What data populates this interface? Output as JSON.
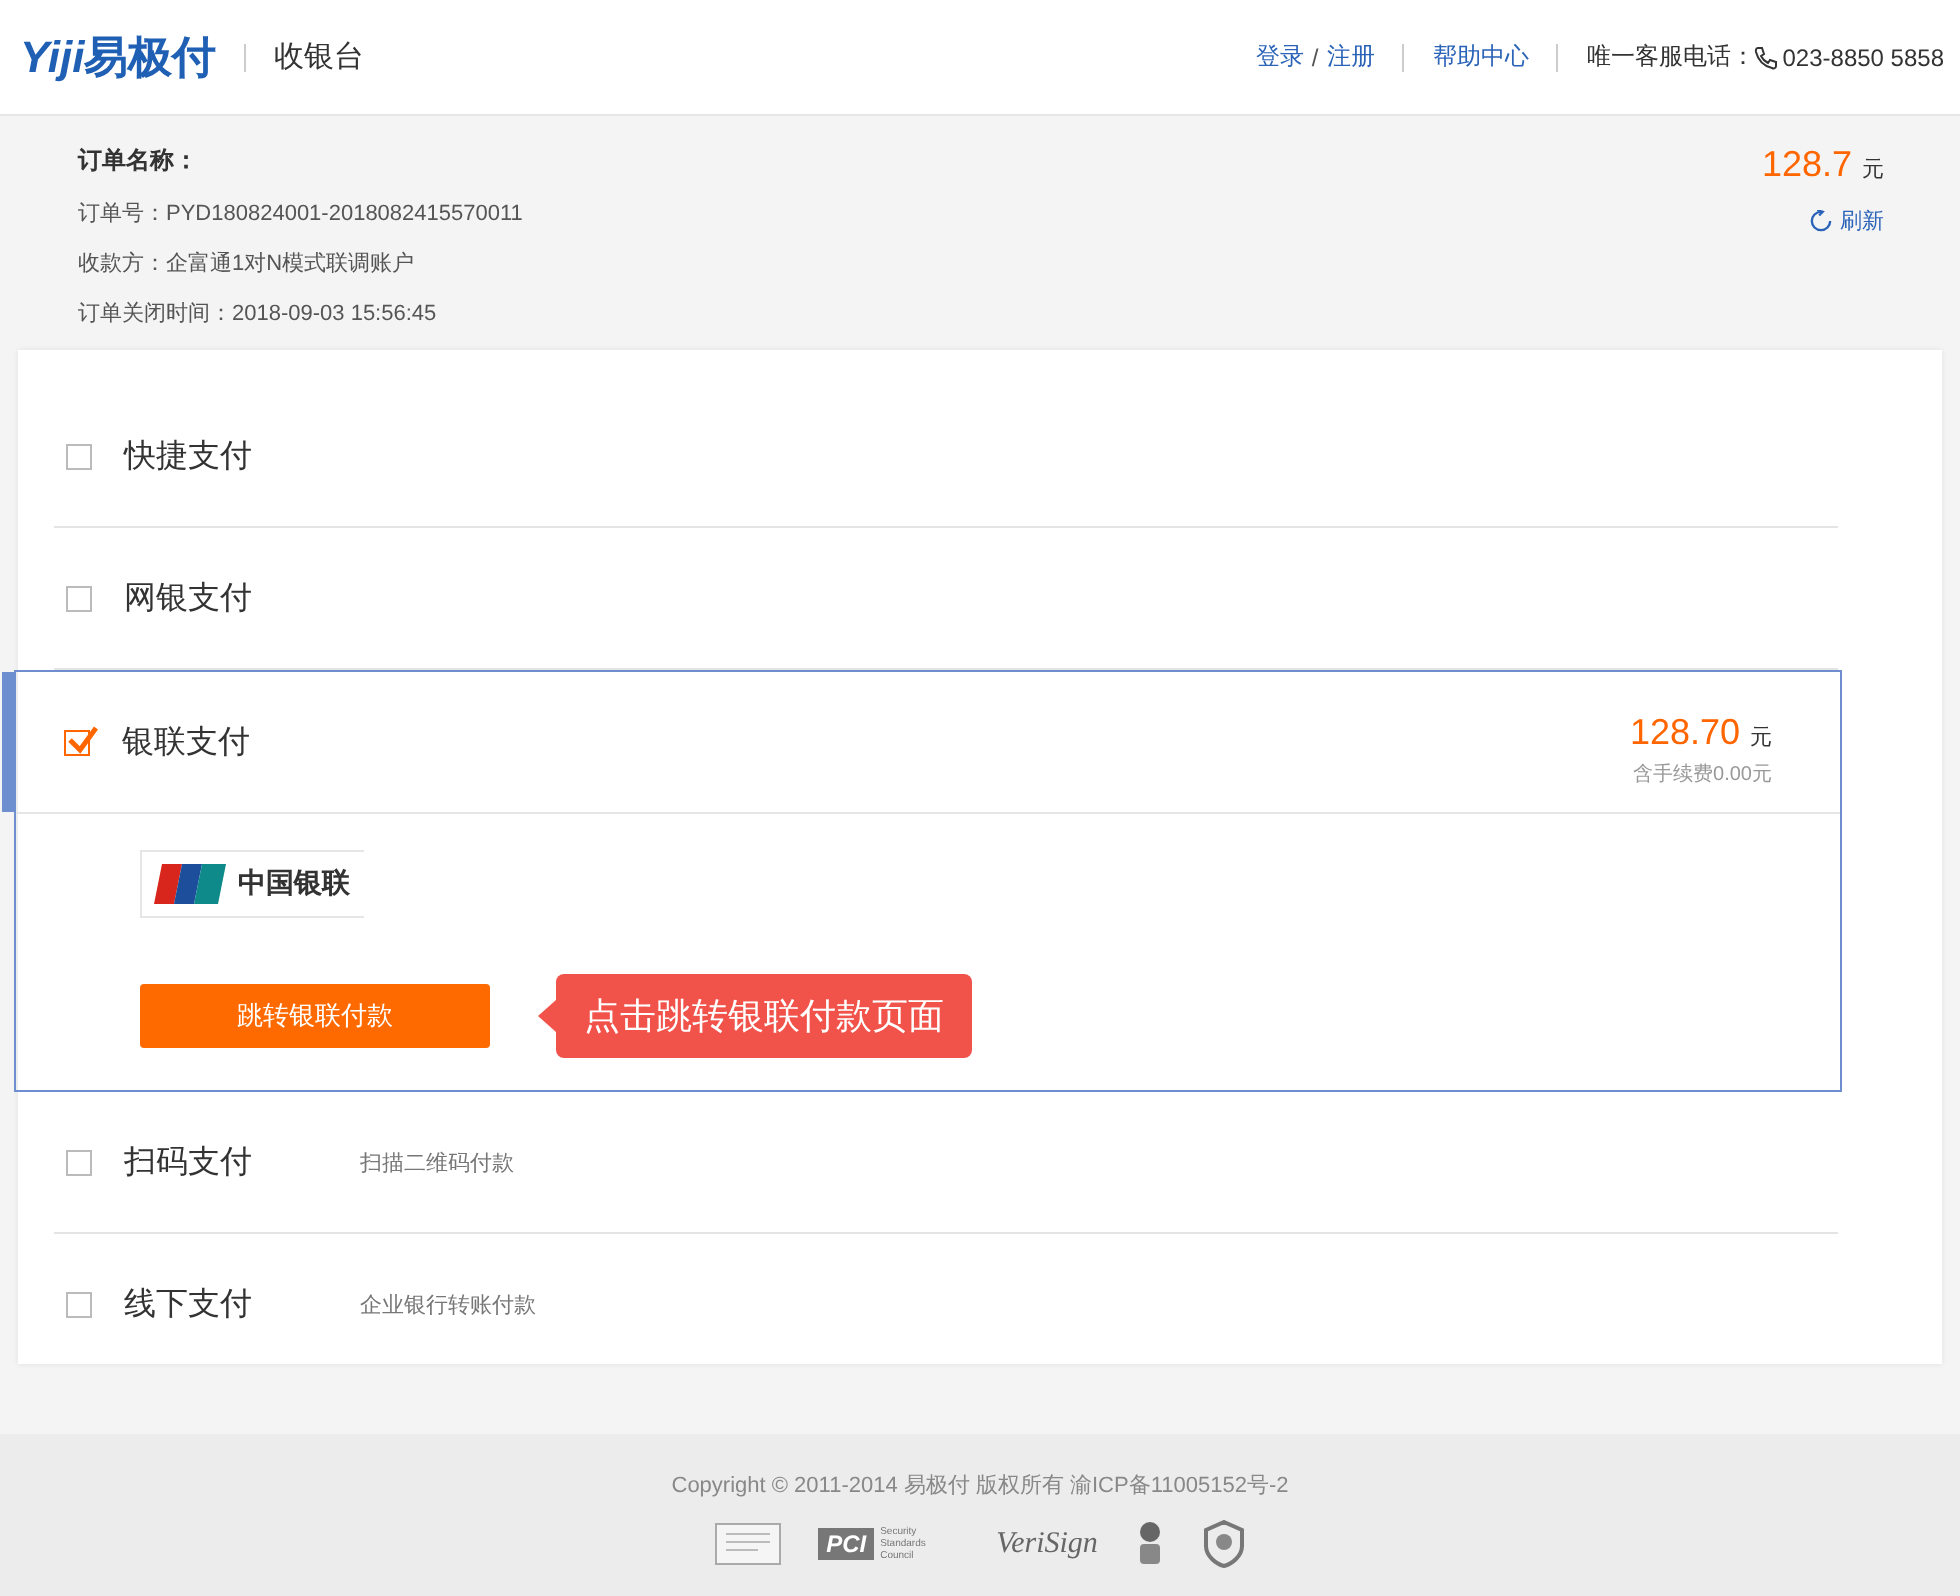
{
  "header": {
    "logo_latin": "Yiji",
    "logo_cn": "易极付",
    "title": "收银台",
    "links": [
      {
        "label": "登录"
      },
      {
        "label": "注册"
      }
    ],
    "link_separator": "/",
    "help": "帮助中心",
    "hotline_label": "唯一客服电话：",
    "hotline": "023-8850 5858"
  },
  "order": {
    "name_label": "订单名称：",
    "details": [
      "订单号：PYD180824001-2018082415570011",
      "收款方：企富通1对N模式联调账户",
      "订单关闭时间：2018-09-03 15:56:45"
    ],
    "amount": "128.7",
    "currency": "元",
    "refresh": "刷新"
  },
  "methods": [
    {
      "name": "快捷支付",
      "selected": false
    },
    {
      "name": "网银支付",
      "selected": false
    },
    {
      "name": "银联支付",
      "selected": true,
      "amount": "128.70",
      "currency": "元",
      "fee": "含手续费0.00元",
      "bank": "中国银联",
      "button": "跳转银联付款",
      "callout": "点击跳转银联付款页面"
    },
    {
      "name": "扫码支付",
      "selected": false,
      "hint": "扫描二维码付款"
    },
    {
      "name": "线下支付",
      "selected": false,
      "hint": "企业银行转账付款"
    }
  ],
  "footer": {
    "copyright": "Copyright © 2011-2014 易极付 版权所有 渝ICP备11005152号-2",
    "badges": [
      {
        "kind": "certificate"
      },
      {
        "kind": "pci",
        "label": "PCI",
        "sub": "Security Standards Council"
      },
      {
        "kind": "verisign",
        "label": "VeriSign"
      },
      {
        "kind": "emblem"
      },
      {
        "kind": "shield"
      }
    ]
  }
}
